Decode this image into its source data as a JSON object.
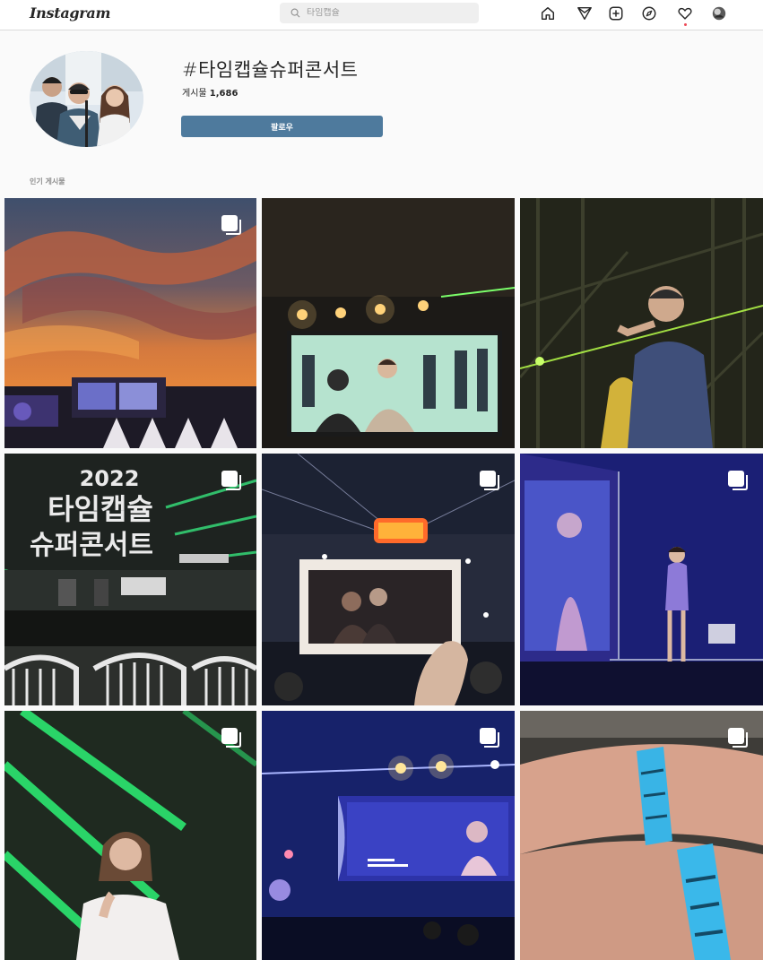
{
  "nav": {
    "logo": "Instagram",
    "search_placeholder": "타임캡슐",
    "icons": [
      "home-icon",
      "direct-icon",
      "new-post-icon",
      "explore-icon",
      "activity-icon",
      "profile-avatar"
    ]
  },
  "header": {
    "hashtag": "#타임캡슐슈퍼콘서트",
    "posts_label": "게시물",
    "posts_count": "1,686",
    "follow_label": "팔로우"
  },
  "section": {
    "top_posts_label": "인기 게시물"
  },
  "grid": {
    "posts": [
      {
        "icon": "multi-photo-icon",
        "scene": "sunset-stage"
      },
      {
        "icon": "none",
        "scene": "screen-duo"
      },
      {
        "icon": "none",
        "scene": "singer-laser"
      },
      {
        "icon": "multi-photo-icon",
        "scene": "stage-banner",
        "banner_lines": [
          "2022",
          "타임캡슐",
          "슈퍼콘서트"
        ]
      },
      {
        "icon": "multi-photo-icon",
        "scene": "photo-card"
      },
      {
        "icon": "multi-photo-icon",
        "scene": "singer-purple"
      },
      {
        "icon": "multi-photo-icon",
        "scene": "singer-green"
      },
      {
        "icon": "multi-photo-icon",
        "scene": "screen-blue"
      },
      {
        "icon": "multi-photo-icon",
        "scene": "wristbands"
      }
    ]
  },
  "colors": {
    "accent": "#4e7a9d",
    "notification": "#ed4956",
    "background": "#fafafa"
  }
}
